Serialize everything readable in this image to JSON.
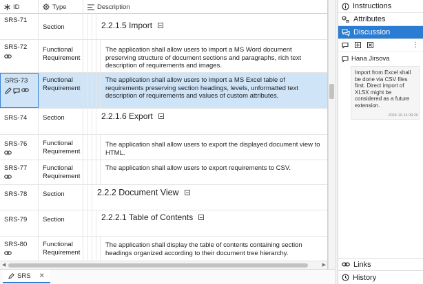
{
  "grid": {
    "columns": {
      "id": "ID",
      "type": "Type",
      "description": "Description"
    },
    "rows": [
      {
        "id": "SRS-71",
        "type": "Section",
        "heading": "2.2.1.5 Import",
        "text": ""
      },
      {
        "id": "SRS-72",
        "type": "Functional Requirement",
        "heading": "",
        "text": "The application shall allow users to import a MS Word document preserving structure of document sections and paragraphs, rich text description of requirements and images."
      },
      {
        "id": "SRS-73",
        "type": "Functional Requirement",
        "heading": "",
        "text": "The application shall allow users to import a MS Excel table of requirements preserving section headings, levels, unformatted text description of requirements and values of custom attributes."
      },
      {
        "id": "SRS-74",
        "type": "Section",
        "heading": "2.2.1.6 Export",
        "text": ""
      },
      {
        "id": "SRS-76",
        "type": "Functional Requirement",
        "heading": "",
        "text": "The application shall allow users to export the displayed document view to HTML."
      },
      {
        "id": "SRS-77",
        "type": "Functional Requirement",
        "heading": "",
        "text": "The application shall allow users to export requirements to CSV."
      },
      {
        "id": "SRS-78",
        "type": "Section",
        "heading": "2.2.2 Document View",
        "text": ""
      },
      {
        "id": "SRS-79",
        "type": "Section",
        "heading": "2.2.2.1 Table of Contents",
        "text": ""
      },
      {
        "id": "SRS-80",
        "type": "Functional Requirement",
        "heading": "",
        "text": "The application shall display the table of contents containing section headings organized according to their document tree hierarchy."
      }
    ]
  },
  "bottom_tab": {
    "label": "SRS"
  },
  "side_panel": {
    "tabs": {
      "instructions": "Instructions",
      "attributes": "Attributes",
      "discussion": "Discussion",
      "links": "Links",
      "history": "History"
    },
    "comment": {
      "author": "Hana Jirsova",
      "text": "Import from Excel shall be done via CSV files first. Direct import of XLSX might be considered as a future extension.",
      "timestamp": "2024-10-14 09:26"
    }
  },
  "colors": {
    "accent": "#2b7cd3",
    "selected_row": "#cfe4f7"
  },
  "icons": [
    "asterisk-icon",
    "gear-icon",
    "list-lines-icon",
    "link-icon",
    "pencil-icon",
    "comment-icon",
    "info-icon",
    "attributes-icon",
    "discussion-icon",
    "add-comment-icon",
    "expand-icon",
    "more-vertical-icon",
    "user-comment-icon"
  ]
}
